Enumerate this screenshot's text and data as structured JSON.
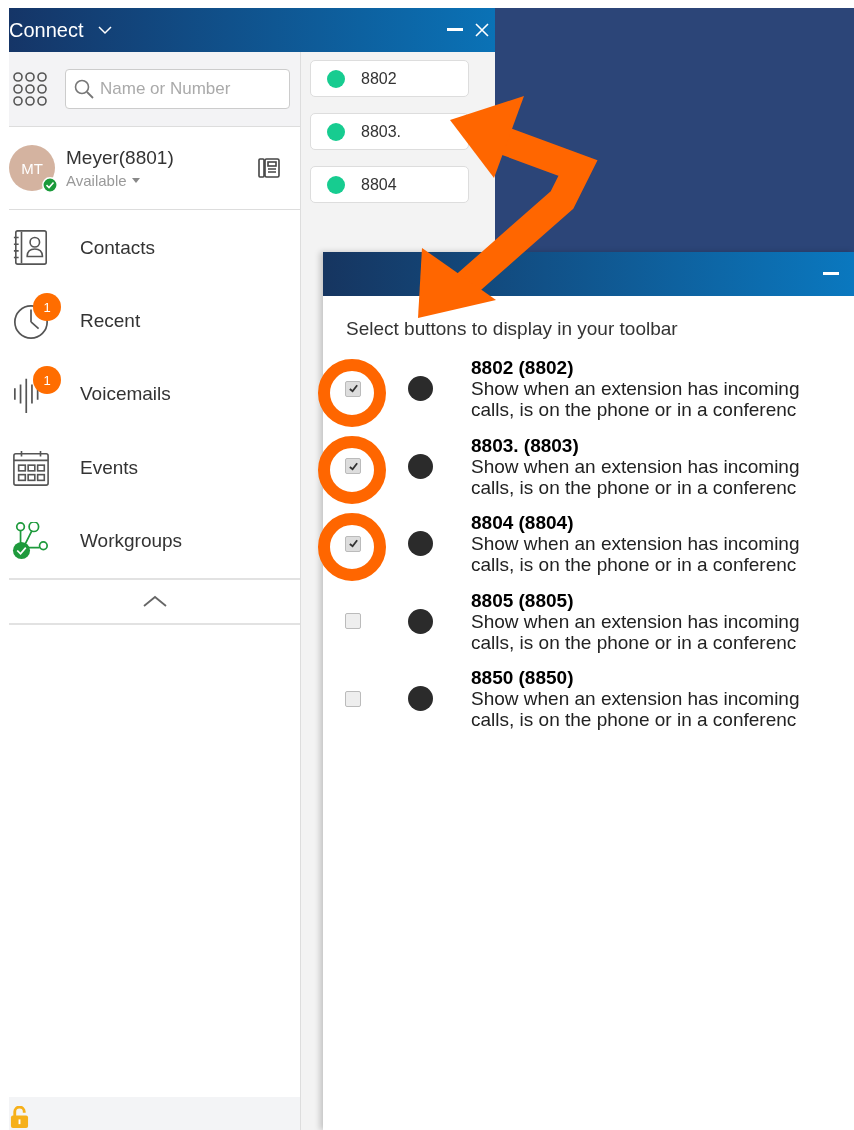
{
  "main_window": {
    "title": "Connect",
    "search": {
      "placeholder": "Name or Number"
    },
    "user": {
      "initials": "MT",
      "name": "Meyer(8801)",
      "status": "Available"
    },
    "nav": [
      {
        "kind": "contacts",
        "label": "Contacts"
      },
      {
        "kind": "recent",
        "label": "Recent",
        "badge": "1"
      },
      {
        "kind": "voicemails",
        "label": "Voicemails",
        "badge": "1"
      },
      {
        "kind": "events",
        "label": "Events"
      },
      {
        "kind": "workgroups",
        "label": "Workgroups"
      }
    ],
    "toolbar_buttons": [
      {
        "label": "8802"
      },
      {
        "label": "8803."
      },
      {
        "label": "8804"
      }
    ]
  },
  "dialog": {
    "heading": "Select buttons to display in your toolbar",
    "options": [
      {
        "title": "8802 (8802)",
        "description_lines": [
          "Show when an extension has incoming",
          "calls, is on the phone or in a conferenc"
        ],
        "checked": true
      },
      {
        "title": "8803. (8803)",
        "description_lines": [
          "Show when an extension has incoming",
          "calls, is on the phone or in a conferenc"
        ],
        "checked": true
      },
      {
        "title": "8804 (8804)",
        "description_lines": [
          "Show when an extension has incoming",
          "calls, is on the phone or in a conferenc"
        ],
        "checked": true
      },
      {
        "title": "8805 (8805)",
        "description_lines": [
          "Show when an extension has incoming",
          "calls, is on the phone or in a conferenc"
        ],
        "checked": false
      },
      {
        "title": "8850 (8850)",
        "description_lines": [
          "Show when an extension has incoming",
          "calls, is on the phone or in a conferenc"
        ],
        "checked": false
      }
    ]
  }
}
